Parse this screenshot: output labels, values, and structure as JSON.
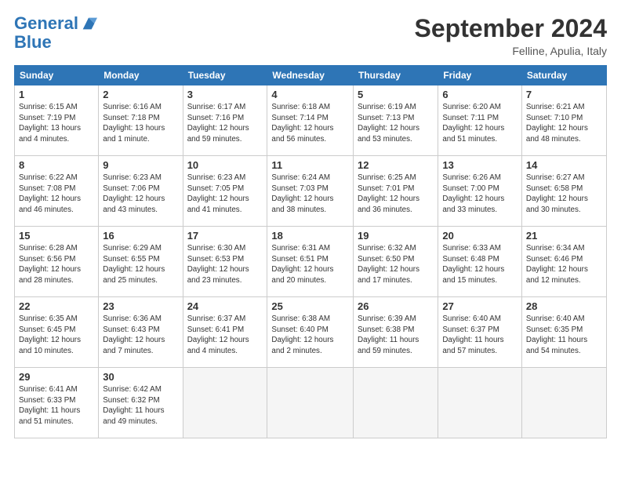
{
  "header": {
    "logo_line1": "General",
    "logo_line2": "Blue",
    "month_title": "September 2024",
    "subtitle": "Felline, Apulia, Italy"
  },
  "days_of_week": [
    "Sunday",
    "Monday",
    "Tuesday",
    "Wednesday",
    "Thursday",
    "Friday",
    "Saturday"
  ],
  "weeks": [
    [
      {
        "num": "1",
        "info": "Sunrise: 6:15 AM\nSunset: 7:19 PM\nDaylight: 13 hours\nand 4 minutes."
      },
      {
        "num": "2",
        "info": "Sunrise: 6:16 AM\nSunset: 7:18 PM\nDaylight: 13 hours\nand 1 minute."
      },
      {
        "num": "3",
        "info": "Sunrise: 6:17 AM\nSunset: 7:16 PM\nDaylight: 12 hours\nand 59 minutes."
      },
      {
        "num": "4",
        "info": "Sunrise: 6:18 AM\nSunset: 7:14 PM\nDaylight: 12 hours\nand 56 minutes."
      },
      {
        "num": "5",
        "info": "Sunrise: 6:19 AM\nSunset: 7:13 PM\nDaylight: 12 hours\nand 53 minutes."
      },
      {
        "num": "6",
        "info": "Sunrise: 6:20 AM\nSunset: 7:11 PM\nDaylight: 12 hours\nand 51 minutes."
      },
      {
        "num": "7",
        "info": "Sunrise: 6:21 AM\nSunset: 7:10 PM\nDaylight: 12 hours\nand 48 minutes."
      }
    ],
    [
      {
        "num": "8",
        "info": "Sunrise: 6:22 AM\nSunset: 7:08 PM\nDaylight: 12 hours\nand 46 minutes."
      },
      {
        "num": "9",
        "info": "Sunrise: 6:23 AM\nSunset: 7:06 PM\nDaylight: 12 hours\nand 43 minutes."
      },
      {
        "num": "10",
        "info": "Sunrise: 6:23 AM\nSunset: 7:05 PM\nDaylight: 12 hours\nand 41 minutes."
      },
      {
        "num": "11",
        "info": "Sunrise: 6:24 AM\nSunset: 7:03 PM\nDaylight: 12 hours\nand 38 minutes."
      },
      {
        "num": "12",
        "info": "Sunrise: 6:25 AM\nSunset: 7:01 PM\nDaylight: 12 hours\nand 36 minutes."
      },
      {
        "num": "13",
        "info": "Sunrise: 6:26 AM\nSunset: 7:00 PM\nDaylight: 12 hours\nand 33 minutes."
      },
      {
        "num": "14",
        "info": "Sunrise: 6:27 AM\nSunset: 6:58 PM\nDaylight: 12 hours\nand 30 minutes."
      }
    ],
    [
      {
        "num": "15",
        "info": "Sunrise: 6:28 AM\nSunset: 6:56 PM\nDaylight: 12 hours\nand 28 minutes."
      },
      {
        "num": "16",
        "info": "Sunrise: 6:29 AM\nSunset: 6:55 PM\nDaylight: 12 hours\nand 25 minutes."
      },
      {
        "num": "17",
        "info": "Sunrise: 6:30 AM\nSunset: 6:53 PM\nDaylight: 12 hours\nand 23 minutes."
      },
      {
        "num": "18",
        "info": "Sunrise: 6:31 AM\nSunset: 6:51 PM\nDaylight: 12 hours\nand 20 minutes."
      },
      {
        "num": "19",
        "info": "Sunrise: 6:32 AM\nSunset: 6:50 PM\nDaylight: 12 hours\nand 17 minutes."
      },
      {
        "num": "20",
        "info": "Sunrise: 6:33 AM\nSunset: 6:48 PM\nDaylight: 12 hours\nand 15 minutes."
      },
      {
        "num": "21",
        "info": "Sunrise: 6:34 AM\nSunset: 6:46 PM\nDaylight: 12 hours\nand 12 minutes."
      }
    ],
    [
      {
        "num": "22",
        "info": "Sunrise: 6:35 AM\nSunset: 6:45 PM\nDaylight: 12 hours\nand 10 minutes."
      },
      {
        "num": "23",
        "info": "Sunrise: 6:36 AM\nSunset: 6:43 PM\nDaylight: 12 hours\nand 7 minutes."
      },
      {
        "num": "24",
        "info": "Sunrise: 6:37 AM\nSunset: 6:41 PM\nDaylight: 12 hours\nand 4 minutes."
      },
      {
        "num": "25",
        "info": "Sunrise: 6:38 AM\nSunset: 6:40 PM\nDaylight: 12 hours\nand 2 minutes."
      },
      {
        "num": "26",
        "info": "Sunrise: 6:39 AM\nSunset: 6:38 PM\nDaylight: 11 hours\nand 59 minutes."
      },
      {
        "num": "27",
        "info": "Sunrise: 6:40 AM\nSunset: 6:37 PM\nDaylight: 11 hours\nand 57 minutes."
      },
      {
        "num": "28",
        "info": "Sunrise: 6:40 AM\nSunset: 6:35 PM\nDaylight: 11 hours\nand 54 minutes."
      }
    ],
    [
      {
        "num": "29",
        "info": "Sunrise: 6:41 AM\nSunset: 6:33 PM\nDaylight: 11 hours\nand 51 minutes."
      },
      {
        "num": "30",
        "info": "Sunrise: 6:42 AM\nSunset: 6:32 PM\nDaylight: 11 hours\nand 49 minutes."
      },
      {
        "num": "",
        "info": ""
      },
      {
        "num": "",
        "info": ""
      },
      {
        "num": "",
        "info": ""
      },
      {
        "num": "",
        "info": ""
      },
      {
        "num": "",
        "info": ""
      }
    ]
  ]
}
